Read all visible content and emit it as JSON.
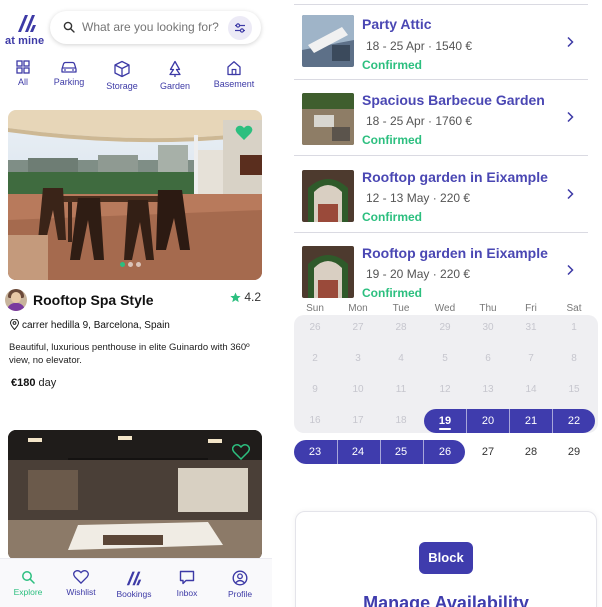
{
  "app": {
    "logo_text": "at mine"
  },
  "search": {
    "placeholder": "What are you looking for?"
  },
  "categories": [
    {
      "label": "All",
      "icon": "grid-icon"
    },
    {
      "label": "Parking",
      "icon": "car-icon"
    },
    {
      "label": "Storage",
      "icon": "box-icon"
    },
    {
      "label": "Garden",
      "icon": "plant-icon"
    },
    {
      "label": "Basement",
      "icon": "house-icon"
    }
  ],
  "listing": {
    "title": "Rooftop Spa Style",
    "rating": "4.2",
    "address": "carrer hedilla 9, Barcelona, Spain",
    "description": "Beautiful, luxurious penthouse in elite Guinardo with 360º view, no elevator.",
    "price_amount": "€180",
    "price_unit": "day"
  },
  "bottom_nav": [
    {
      "label": "Explore",
      "icon": "search-icon",
      "active": true
    },
    {
      "label": "Wishlist",
      "icon": "heart-icon"
    },
    {
      "label": "Bookings",
      "icon": "logo-icon"
    },
    {
      "label": "Inbox",
      "icon": "chat-icon"
    },
    {
      "label": "Profile",
      "icon": "user-icon"
    }
  ],
  "bookings": [
    {
      "title": "Party Attic",
      "dates": "18 - 25 Apr · 1540 €",
      "status": "Confirmed"
    },
    {
      "title": "Spacious Barbecue Garden",
      "dates": "18 - 25 Apr · 1760 €",
      "status": "Confirmed"
    },
    {
      "title": "Rooftop garden in Eixample",
      "dates": "12 - 13 May · 220 €",
      "status": "Confirmed"
    },
    {
      "title": "Rooftop garden in Eixample",
      "dates": "19 - 20 May · 220 €",
      "status": "Confirmed"
    }
  ],
  "calendar": {
    "weekdays": [
      "Sun",
      "Mon",
      "Tue",
      "Wed",
      "Thu",
      "Fri",
      "Sat"
    ],
    "weeks": [
      [
        "26",
        "27",
        "28",
        "29",
        "30",
        "31",
        "1"
      ],
      [
        "2",
        "3",
        "4",
        "5",
        "6",
        "7",
        "8"
      ],
      [
        "9",
        "10",
        "11",
        "12",
        "13",
        "14",
        "15"
      ],
      [
        "16",
        "17",
        "18",
        "19",
        "20",
        "21",
        "22"
      ],
      [
        "23",
        "24",
        "25",
        "26",
        "27",
        "28",
        "29"
      ]
    ],
    "selected_start": "19",
    "selected_end": "26"
  },
  "availability": {
    "block_label": "Block",
    "title": "Manage Availability"
  },
  "colors": {
    "brand": "#3f3cad",
    "confirmed": "#2cbf7f",
    "heart": "#2cbf7f"
  }
}
